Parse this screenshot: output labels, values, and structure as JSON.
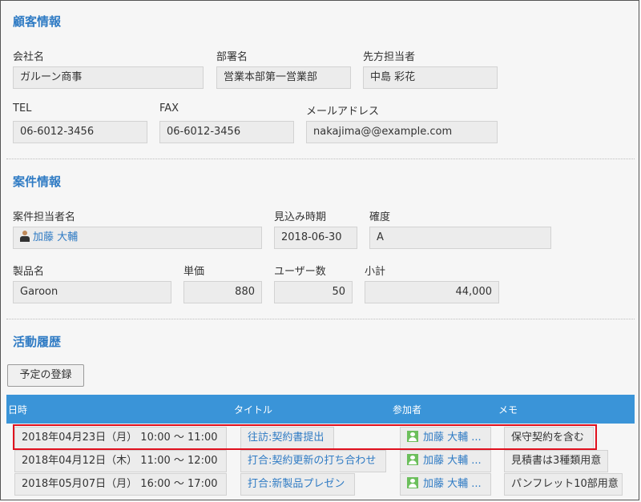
{
  "customer": {
    "title": "顧客情報",
    "company_label": "会社名",
    "company": "ガルーン商事",
    "dept_label": "部署名",
    "dept": "営業本部第一営業部",
    "contact_label": "先方担当者",
    "contact": "中島 彩花",
    "tel_label": "TEL",
    "tel": "06-6012-3456",
    "fax_label": "FAX",
    "fax": "06-6012-3456",
    "email_label": "メールアドレス",
    "email": "nakajima@@example.com"
  },
  "deal": {
    "title": "案件情報",
    "owner_label": "案件担当者名",
    "owner": "加藤 大輔",
    "date_label": "見込み時期",
    "date": "2018-06-30",
    "certainty_label": "確度",
    "certainty": "A",
    "product_label": "製品名",
    "product": "Garoon",
    "price_label": "単価",
    "price": "880",
    "users_label": "ユーザー数",
    "users": "50",
    "subtotal_label": "小計",
    "subtotal": "44,000"
  },
  "activity": {
    "title": "活動履歴",
    "add_button": "予定の登録",
    "columns": [
      "日時",
      "タイトル",
      "参加者",
      "メモ"
    ],
    "rows": [
      {
        "datetime": "2018年04月23日（月） 10:00 ～ 11:00",
        "title": "往訪:契約書提出",
        "participant": "加藤 大輔 ...",
        "memo": "保守契約を含む"
      },
      {
        "datetime": "2018年04月12日（木） 11:00 ～ 12:00",
        "title": "打合:契約更新の打ち合わせ",
        "participant": "加藤 大輔 ...",
        "memo": "見積書は3種類用意"
      },
      {
        "datetime": "2018年05月07日（月） 16:00 ～ 17:00",
        "title": "打合:新製品プレゼン",
        "participant": "加藤 大輔 ...",
        "memo": "パンフレット10部用意"
      }
    ]
  },
  "colors": {
    "accent": "#2f7bc4",
    "header": "#3a94d8",
    "highlight": "#e0101e"
  }
}
